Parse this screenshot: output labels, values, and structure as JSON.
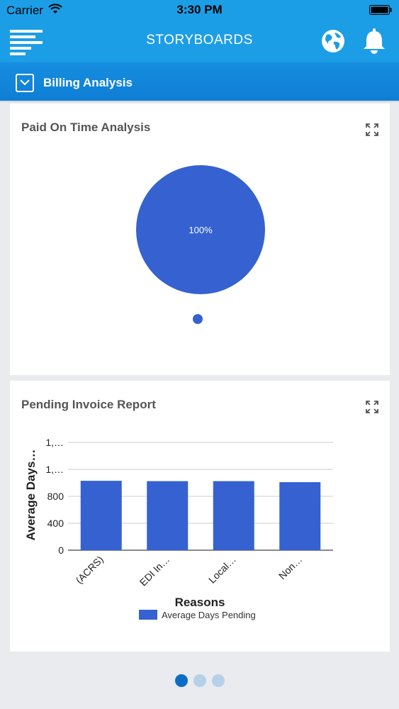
{
  "status_bar": {
    "carrier": "Carrier",
    "time": "3:30 PM"
  },
  "nav": {
    "title": "STORYBOARDS",
    "icons": [
      "menu-icon",
      "globe-icon",
      "bell-icon"
    ]
  },
  "subbar": {
    "label": "Billing Analysis"
  },
  "cards": [
    {
      "title": "Paid On Time Analysis",
      "chart_data": {
        "type": "pie",
        "slices": [
          {
            "label": "100%",
            "value": 100,
            "color": "#3562d0"
          }
        ],
        "legend": [
          "dot"
        ]
      }
    },
    {
      "title": "Pending Invoice Report",
      "chart_data": {
        "type": "bar",
        "categories": [
          "(ACRS)",
          "EDI In…",
          "Local…",
          "Non…"
        ],
        "series": [
          {
            "name": "Average Days Pending",
            "values": [
              1030,
              1025,
              1025,
              1010
            ]
          }
        ],
        "xlabel": "Reasons",
        "ylabel": "Average Days…",
        "yticks": [
          "0",
          "400",
          "800",
          "1,…",
          "1,…"
        ],
        "ylim": [
          0,
          1600
        ],
        "grid": true,
        "legend": "bottom",
        "color": "#3562d0"
      }
    }
  ],
  "pager": {
    "pages": 3,
    "active": 0
  }
}
